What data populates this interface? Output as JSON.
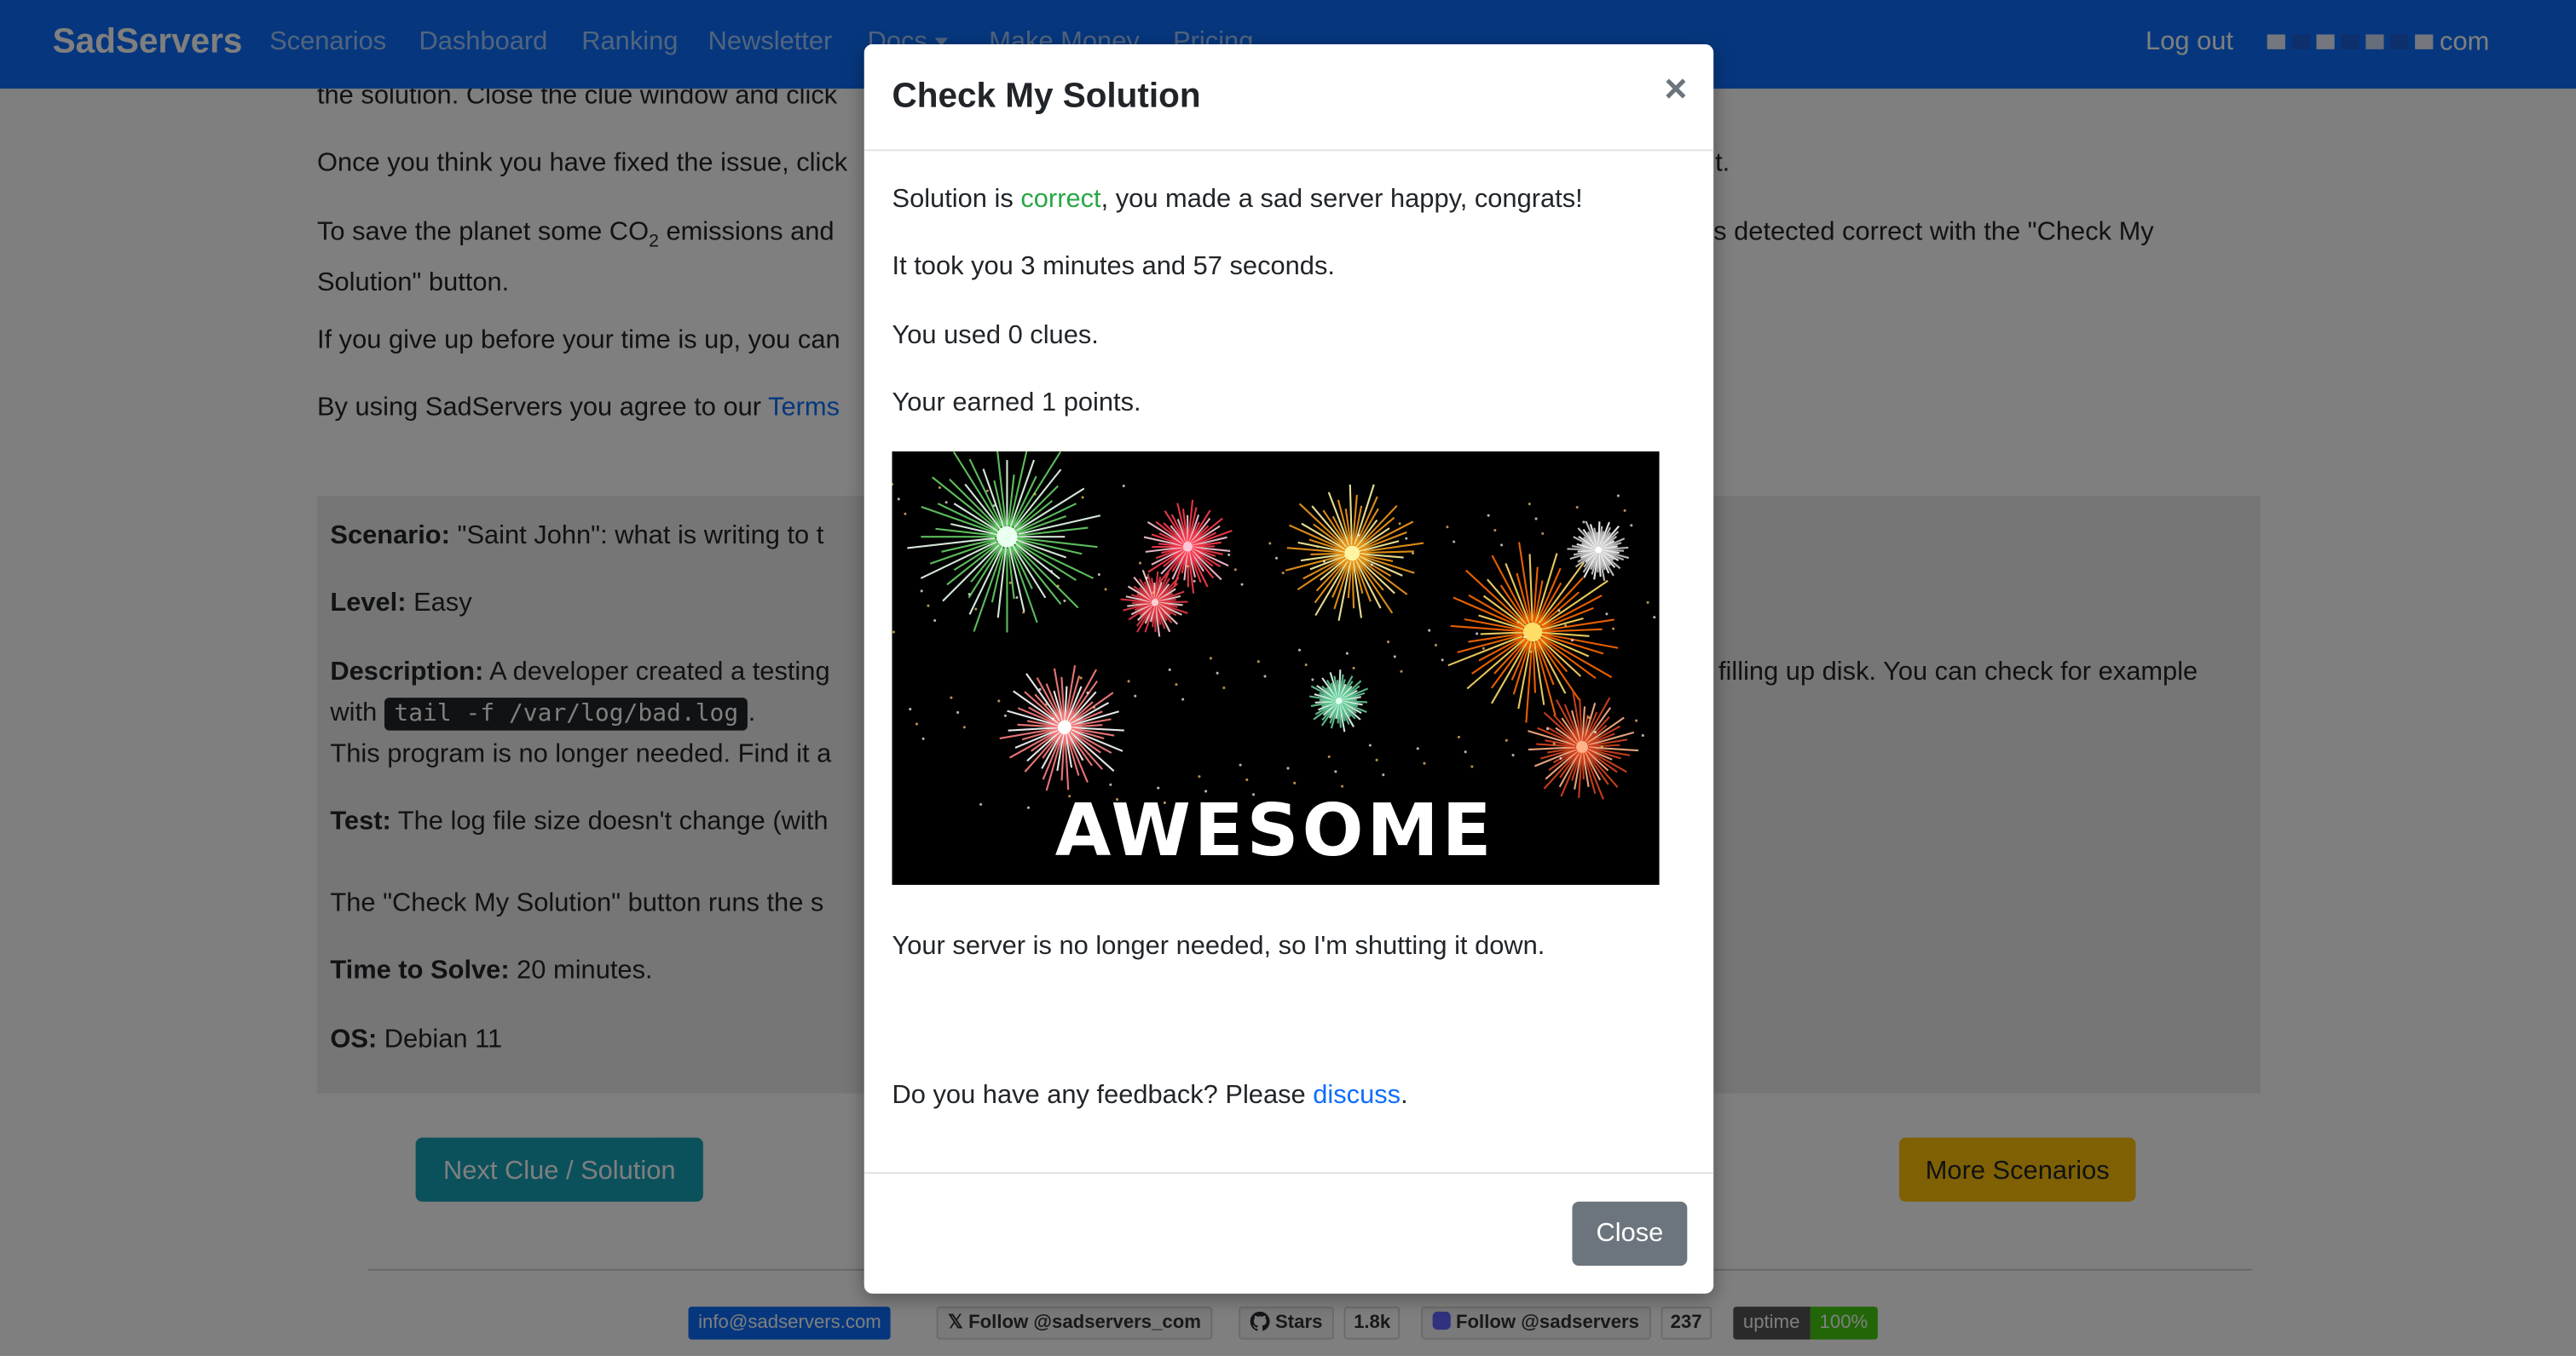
{
  "navbar": {
    "brand": "SadServers",
    "links": [
      "Scenarios",
      "Dashboard",
      "Ranking",
      "Newsletter",
      "Docs",
      "Make Money",
      "Pricing"
    ],
    "logout": "Log out",
    "email_suffix": "com"
  },
  "page": {
    "intro_1": "the solution. Close the clue window and click",
    "intro_2": "Once you think you have fixed the issue, click",
    "intro_2_tail": "t.",
    "intro_3a": "To save the planet some CO",
    "intro_3_sub": "2",
    "intro_3b": " emissions and",
    "intro_3c": "s detected correct with the \"Check My",
    "intro_3d": "Solution\" button.",
    "intro_4": "If you give up before your time is up, you can",
    "intro_5": "By using SadServers you agree to our ",
    "intro_5_link": "Terms"
  },
  "scenario": {
    "scenario_label": "Scenario:",
    "scenario_value": " \"Saint John\": what is writing to t",
    "level_label": "Level:",
    "level_value": " Easy",
    "description_label": "Description:",
    "description_value": " A developer created a testing",
    "description_tail": " filling up disk. You can check for example",
    "with_text": "with ",
    "command": "tail -f /var/log/bad.log",
    "period": ".",
    "no_longer": "This program is no longer needed. Find it a",
    "test_label": "Test:",
    "test_value": " The log file size doesn't change (with",
    "check_text": "The \"Check My Solution\" button runs the s",
    "time_label": "Time to Solve:",
    "time_value": " 20 minutes.",
    "os_label": "OS:",
    "os_value": " Debian 11"
  },
  "buttons": {
    "next_clue": "Next Clue / Solution",
    "more_scenarios": "More Scenarios"
  },
  "footer": {
    "email": "info@sadservers.com",
    "twitter": "Follow @sadservers_com",
    "github_label": "Stars",
    "github_count": "1.8k",
    "mastodon": "Follow @sadservers",
    "mastodon_count": "237",
    "uptime_label": "uptime",
    "uptime_value": "100%"
  },
  "modal": {
    "title": "Check My Solution",
    "close_x": "×",
    "line1_a": "Solution is ",
    "line1_correct": "correct",
    "line1_b": ", you made a sad server happy, congrats!",
    "line2": "It took you 3 minutes and 57 seconds.",
    "line3": "You used 0 clues.",
    "line4": "Your earned 1 points.",
    "image_caption": "AWESOME",
    "shutdown": "Your server is no longer needed, so I'm shutting it down.",
    "feedback_a": "Do you have any feedback? Please ",
    "feedback_link": "discuss",
    "feedback_b": ".",
    "close_button": "Close"
  },
  "colors": {
    "navbar": "#0d6efd",
    "correct": "#28a745",
    "link": "#0d6efd",
    "info_button": "#17a2b8",
    "warning_button": "#ffc107",
    "secondary_button": "#6c757d"
  }
}
